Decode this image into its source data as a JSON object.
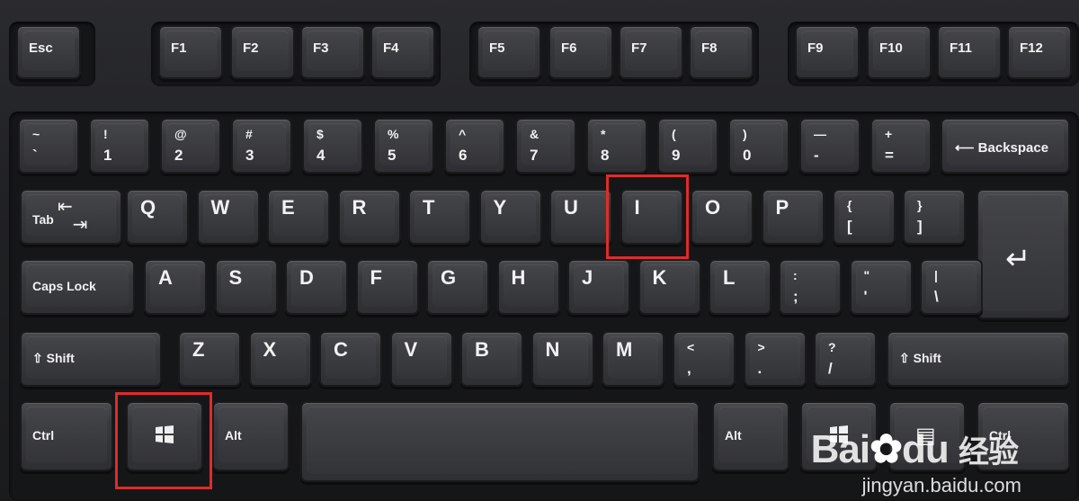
{
  "function_row": [
    {
      "name": "esc",
      "label": "Esc"
    },
    {
      "name": "f1",
      "label": "F1"
    },
    {
      "name": "f2",
      "label": "F2"
    },
    {
      "name": "f3",
      "label": "F3"
    },
    {
      "name": "f4",
      "label": "F4"
    },
    {
      "name": "f5",
      "label": "F5"
    },
    {
      "name": "f6",
      "label": "F6"
    },
    {
      "name": "f7",
      "label": "F7"
    },
    {
      "name": "f8",
      "label": "F8"
    },
    {
      "name": "f9",
      "label": "F9"
    },
    {
      "name": "f10",
      "label": "F10"
    },
    {
      "name": "f11",
      "label": "F11"
    },
    {
      "name": "f12",
      "label": "F12"
    }
  ],
  "number_row": [
    {
      "top": "~",
      "bottom": "`"
    },
    {
      "top": "!",
      "bottom": "1"
    },
    {
      "top": "@",
      "bottom": "2"
    },
    {
      "top": "#",
      "bottom": "3"
    },
    {
      "top": "$",
      "bottom": "4"
    },
    {
      "top": "%",
      "bottom": "5"
    },
    {
      "top": "^",
      "bottom": "6"
    },
    {
      "top": "&",
      "bottom": "7"
    },
    {
      "top": "*",
      "bottom": "8"
    },
    {
      "top": "(",
      "bottom": "9"
    },
    {
      "top": ")",
      "bottom": "0"
    },
    {
      "top": "—",
      "bottom": "-"
    },
    {
      "top": "+",
      "bottom": "="
    }
  ],
  "backspace_label": "Backspace",
  "tab_label": "Tab",
  "qwerty_row": [
    "Q",
    "W",
    "E",
    "R",
    "T",
    "Y",
    "U",
    "I",
    "O",
    "P"
  ],
  "bracket_keys": [
    {
      "top": "{",
      "bottom": "["
    },
    {
      "top": "}",
      "bottom": "]"
    }
  ],
  "caps_label": "Caps Lock",
  "home_row": [
    "A",
    "S",
    "D",
    "F",
    "G",
    "H",
    "J",
    "K",
    "L"
  ],
  "home_punct": [
    {
      "top": ":",
      "bottom": ";"
    },
    {
      "top": "\"",
      "bottom": "'"
    },
    {
      "top": "|",
      "bottom": "\\"
    }
  ],
  "shift_label": "Shift",
  "bottom_letters": [
    "Z",
    "X",
    "C",
    "V",
    "B",
    "N",
    "M"
  ],
  "bottom_punct": [
    {
      "top": "<",
      "bottom": ","
    },
    {
      "top": ">",
      "bottom": "."
    },
    {
      "top": "?",
      "bottom": "/"
    }
  ],
  "ctrl_label": "Ctrl",
  "alt_label": "Alt",
  "watermark": {
    "brand": "Bai",
    "brand2": "du",
    "cn": "经验",
    "url": "jingyan.baidu.com"
  },
  "highlight_color": "#e02b2b"
}
